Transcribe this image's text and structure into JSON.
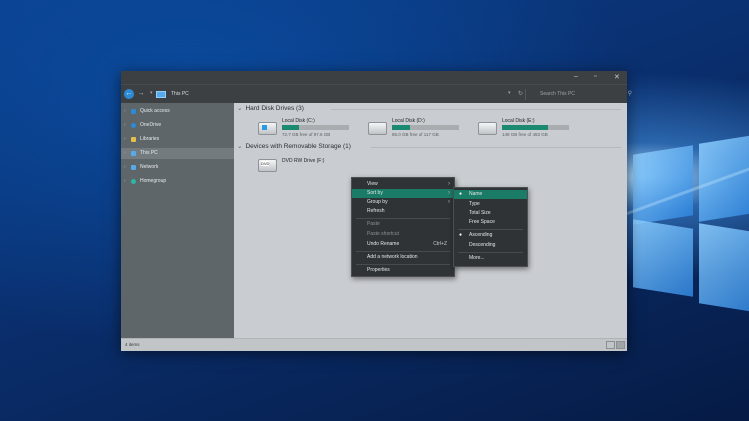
{
  "window": {
    "controls": {
      "minimize": "–",
      "maximize": "▫",
      "close": "✕"
    }
  },
  "address": {
    "breadcrumb": "This PC",
    "search_placeholder": "Search This PC"
  },
  "sidebar": {
    "items": [
      {
        "label": "Quick access",
        "icon_color": "#2d8bd6"
      },
      {
        "label": "OneDrive",
        "icon_color": "#2d8bd6"
      },
      {
        "label": "Libraries",
        "icon_color": "#e3c04a"
      },
      {
        "label": "This PC",
        "icon_color": "#58a9e8"
      },
      {
        "label": "Network",
        "icon_color": "#58a9e8"
      },
      {
        "label": "Homegroup",
        "icon_color": "#2fb6a5"
      }
    ]
  },
  "content": {
    "group_hdd": "Hard Disk Drives (3)",
    "group_removable": "Devices with Removable Storage (1)",
    "drives": [
      {
        "name": "Local Disk (C:)",
        "free": "72.7 GB free of 97.6 GB",
        "used_fraction": 0.26
      },
      {
        "name": "Local Disk (D:)",
        "free": "85.0 GB free of 117 GB",
        "used_fraction": 0.27
      },
      {
        "name": "Local Disk (E:)",
        "free": "149 GB free of 483 GB",
        "used_fraction": 0.69
      }
    ],
    "dvd": {
      "name": "DVD RW Drive (F:)",
      "badge": "DVD"
    }
  },
  "status": {
    "count": "4 items"
  },
  "context_menu": {
    "view": "View",
    "sort_by": "Sort by",
    "group_by": "Group by",
    "refresh": "Refresh",
    "paste": "Paste",
    "paste_shortcut": "Paste shortcut",
    "undo_rename": "Undo Rename",
    "undo_shortcut": "Ctrl+Z",
    "add_network": "Add a network location",
    "properties": "Properties"
  },
  "sort_submenu": {
    "name": "Name",
    "type": "Type",
    "total_size": "Total Size",
    "free_space": "Free Space",
    "ascending": "Ascending",
    "descending": "Descending",
    "more": "More...",
    "bullet": "●"
  },
  "colors": {
    "accent": "#1a7b66",
    "drive_bar": "#1b8a70",
    "sidebar_bg": "#5f666a"
  }
}
